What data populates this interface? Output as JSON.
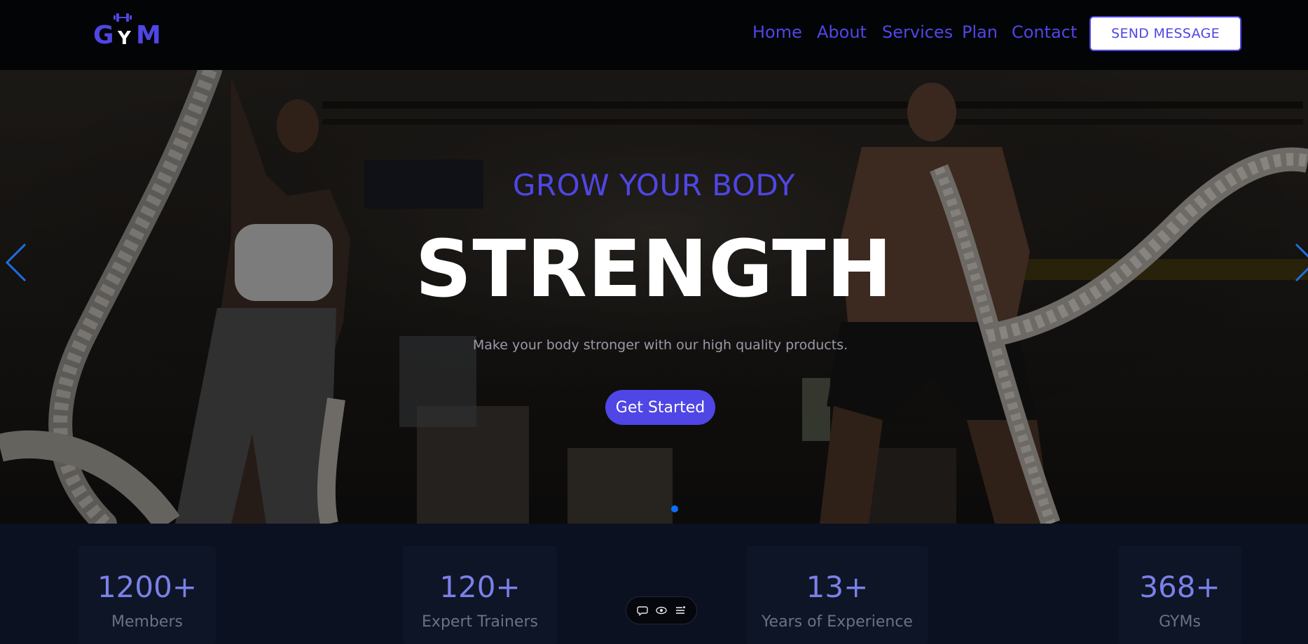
{
  "brand": {
    "letter_g": "G",
    "letter_y": "Y",
    "letter_m": "M",
    "icon": "dumbbell-icon"
  },
  "nav": {
    "items": [
      {
        "label": "Home"
      },
      {
        "label": "About"
      },
      {
        "label": "Services"
      },
      {
        "label": "Plan"
      },
      {
        "label": "Contact"
      }
    ],
    "cta_label": "SEND MESSAGE"
  },
  "hero": {
    "subtitle": "GROW YOUR BODY",
    "title": "STRENGTH",
    "description": "Make your body stronger with our high quality products.",
    "button_label": "Get Started",
    "prev_icon": "chevron-left-icon",
    "next_icon": "chevron-right-icon",
    "slide_count": 1,
    "active_slide": 1
  },
  "stats": [
    {
      "value": "1200+",
      "label": "Members"
    },
    {
      "value": "120+",
      "label": "Expert Trainers"
    },
    {
      "value": "13+",
      "label": "Years of Experience"
    },
    {
      "value": "368+",
      "label": "GYMs"
    }
  ],
  "toolbar": {
    "icons": [
      "chat-icon",
      "eye-icon",
      "menu-icon"
    ]
  },
  "colors": {
    "accent": "#4f46e5",
    "nav_bg": "#030406",
    "page_bg": "#0b1120",
    "stat_value": "#7b80e8",
    "dot": "#0d6efd"
  }
}
